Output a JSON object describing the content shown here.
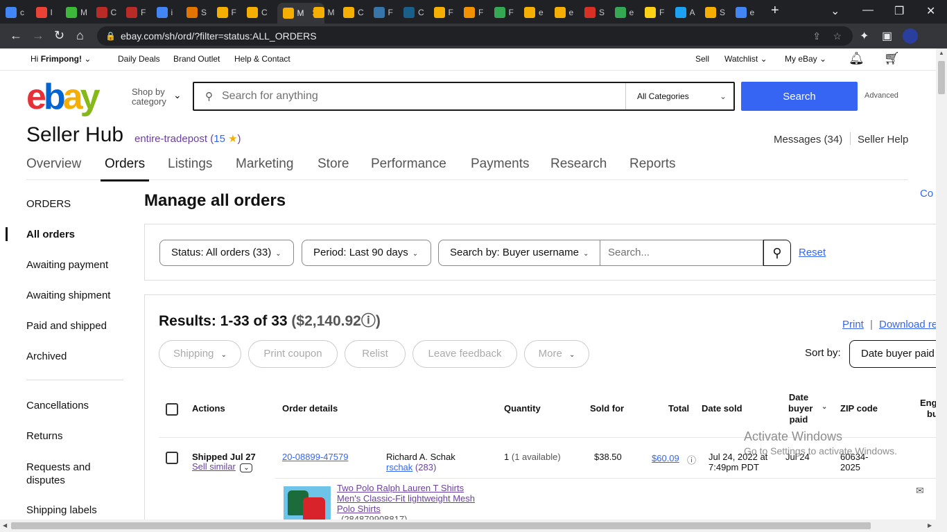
{
  "browser": {
    "tabs": [
      {
        "label": "c",
        "icon": "google-icon",
        "color": "#4285f4"
      },
      {
        "label": "I",
        "icon": "gmail-icon",
        "color": "#ea4335"
      },
      {
        "label": "M",
        "icon": "jiji-icon",
        "color": "#3db83a"
      },
      {
        "label": "C",
        "icon": "quora-icon",
        "color": "#b92b27"
      },
      {
        "label": "F",
        "icon": "quora-icon",
        "color": "#b92b27"
      },
      {
        "label": "i",
        "icon": "google-icon",
        "color": "#4285f4"
      },
      {
        "label": "S",
        "icon": "circle-icon",
        "color": "#e37400"
      },
      {
        "label": "F",
        "icon": "ebay-icon",
        "color": "#f5af02"
      },
      {
        "label": "C",
        "icon": "ebay-icon",
        "color": "#f5af02"
      },
      {
        "label": "M",
        "icon": "ebay-icon",
        "color": "#f5af02",
        "active": true
      },
      {
        "label": "M",
        "icon": "ebay-icon",
        "color": "#f5af02"
      },
      {
        "label": "C",
        "icon": "ebay-icon",
        "color": "#f5af02"
      },
      {
        "label": "F",
        "icon": "python-icon",
        "color": "#3776ab"
      },
      {
        "label": "C",
        "icon": "np-icon",
        "color": "#1a5e8a"
      },
      {
        "label": "F",
        "icon": "ebay-icon",
        "color": "#f5af02"
      },
      {
        "label": "F",
        "icon": "person-icon",
        "color": "#f29200"
      },
      {
        "label": "F",
        "icon": "swirl-icon",
        "color": "#34a853"
      },
      {
        "label": "e",
        "icon": "ebay-icon",
        "color": "#f5af02"
      },
      {
        "label": "e",
        "icon": "moon-icon",
        "color": "#f5af02"
      },
      {
        "label": "S",
        "icon": "cross-icon",
        "color": "#d93025"
      },
      {
        "label": "e",
        "icon": "maps-icon",
        "color": "#34a853"
      },
      {
        "label": "F",
        "icon": "flag-icon",
        "color": "#fcd116"
      },
      {
        "label": "A",
        "icon": "twitter-icon",
        "color": "#1da1f2"
      },
      {
        "label": "S",
        "icon": "ebay-icon",
        "color": "#f5af02"
      },
      {
        "label": "e",
        "icon": "google-icon",
        "color": "#4285f4"
      }
    ],
    "url": "ebay.com/sh/ord/?filter=status:ALL_ORDERS"
  },
  "topnav": {
    "greeting_prefix": "Hi",
    "greeting_name": "Frimpong!",
    "daily_deals": "Daily Deals",
    "brand_outlet": "Brand Outlet",
    "help_contact": "Help & Contact",
    "sell": "Sell",
    "watchlist": "Watchlist",
    "my_ebay": "My eBay"
  },
  "header": {
    "shop_by_line1": "Shop by",
    "shop_by_line2": "category",
    "search_placeholder": "Search for anything",
    "category": "All Categories",
    "search_button": "Search",
    "advanced": "Advanced"
  },
  "hub": {
    "title": "Seller Hub",
    "seller_name": "entire-tradepost",
    "feedback_score": "15",
    "messages": "Messages (34)",
    "seller_help": "Seller Help",
    "tabs": [
      "Overview",
      "Orders",
      "Listings",
      "Marketing",
      "Store",
      "Performance",
      "Payments",
      "Research",
      "Reports"
    ],
    "active_tab": "Orders"
  },
  "sidebar": {
    "heading": "ORDERS",
    "items": [
      "All orders",
      "Awaiting payment",
      "Awaiting shipment",
      "Paid and shipped",
      "Archived",
      "Cancellations",
      "Returns",
      "Requests and disputes",
      "Shipping labels"
    ],
    "active": "All orders"
  },
  "main": {
    "title": "Manage all orders",
    "corner_link": "Co",
    "filters": {
      "status": "Status: All orders (33)",
      "period": "Period: Last 90 days",
      "search_by": "Search by: Buyer username",
      "search_placeholder": "Search...",
      "reset": "Reset"
    },
    "results": {
      "label": "Results: 1-33 of 33",
      "amount": "($2,140.92",
      "print": "Print",
      "separator": "|",
      "download": "Download re",
      "actions": [
        "Shipping",
        "Print coupon",
        "Relist",
        "Leave feedback",
        "More"
      ],
      "sort_label": "Sort by:",
      "sort_value": "Date buyer paid"
    },
    "table": {
      "headers": {
        "actions": "Actions",
        "order_details": "Order details",
        "quantity": "Quantity",
        "sold_for": "Sold for",
        "total": "Total",
        "date_sold": "Date sold",
        "date_paid_1": "Date",
        "date_paid_2": "buyer",
        "date_paid_3": "paid",
        "zip": "ZIP code",
        "eng_1": "Eng",
        "eng_2": "bu"
      },
      "rows": [
        {
          "status": "Shipped Jul 27",
          "sell_similar": "Sell similar",
          "order_number": "20-08899-47579",
          "buyer_name": "Richard A. Schak",
          "buyer_username": "rschak",
          "buyer_score": "(283)",
          "quantity": "1",
          "available": "(1 available)",
          "sold_for": "$38.50",
          "total": "$60.09",
          "date_sold_1": "Jul 24, 2022 at",
          "date_sold_2": "7:49pm PDT",
          "date_paid": "Jul 24",
          "zip_1": "60634-",
          "zip_2": "2025",
          "item_title_1": "Two Polo Ralph Lauren T Shirts",
          "item_title_2": "Men's Classic-Fit lightweight Mesh",
          "item_title_3": "Polo Shirts",
          "item_id": "(284879908817)"
        }
      ]
    }
  },
  "watermark": {
    "line1": "Activate Windows",
    "line2": "Go to Settings to activate Windows."
  },
  "colors": {
    "accent": "#3665f3",
    "seller_purple": "#6b3ea3",
    "chrome_dark": "#202124"
  }
}
